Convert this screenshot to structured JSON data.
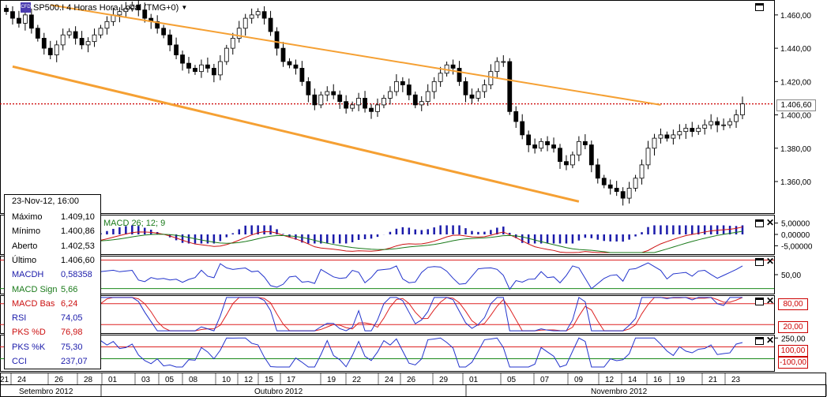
{
  "header": {
    "title": "SP500.I 4 Horas Hora Local (TMG+0)",
    "instrument_icon": "CFD"
  },
  "info_panel": {
    "date": "23-Nov-12, 16:00",
    "rows": [
      {
        "label": "Máximo",
        "value": "1.409,10",
        "color": "#000000"
      },
      {
        "label": "Mínimo",
        "value": "1.400,86",
        "color": "#000000"
      },
      {
        "label": "Aberto",
        "value": "1.402,53",
        "color": "#000000"
      },
      {
        "label": "Último",
        "value": "1.406,60",
        "color": "#000000"
      },
      {
        "label": "MACDH",
        "value": "0,58358",
        "color": "#1a1aaa"
      },
      {
        "label": "MACD Sign",
        "value": "5,66",
        "color": "#1a7a1a"
      },
      {
        "label": "MACD Bas",
        "value": "6,24",
        "color": "#cc1111"
      },
      {
        "label": "RSI",
        "value": "74,05",
        "color": "#1a1aaa"
      },
      {
        "label": "PKS %D",
        "value": "76,98",
        "color": "#cc1111"
      },
      {
        "label": "PKS %K",
        "value": "75,30",
        "color": "#1a1aaa"
      },
      {
        "label": "CCI",
        "value": "237,07",
        "color": "#1a1aaa"
      }
    ]
  },
  "price_axis": {
    "ticks": [
      "1.460,00",
      "1.440,00",
      "1.420,00",
      "1.400,00",
      "1.380,00",
      "1.360,00"
    ],
    "current_price": "1.406,60"
  },
  "macd_panel": {
    "legend": "MACD 26; 12; 9",
    "ticks": [
      "5,00000",
      "0,00000",
      "-5,00000"
    ]
  },
  "rsi_panel": {
    "ticks": [
      "50,00"
    ]
  },
  "stoch_panel": {
    "ticks": [
      "80,00",
      "20,00"
    ]
  },
  "cci_panel": {
    "ticks": [
      "250,00",
      "100,00",
      "-100,00"
    ]
  },
  "x_axis": {
    "days": [
      "21",
      "24",
      "26",
      "28",
      "01",
      "03",
      "05",
      "08",
      "10",
      "12",
      "15",
      "17",
      "19",
      "22",
      "24",
      "26",
      "29",
      "01",
      "05",
      "07",
      "09",
      "12",
      "14",
      "16",
      "19",
      "21",
      "23"
    ],
    "months": [
      "Setembro 2012",
      "Outubro 2012",
      "Novembro 2012"
    ]
  },
  "colors": {
    "candle_up": "#ffffff",
    "candle_down": "#000000",
    "trendline": "#f5a033",
    "price_line": "#cc0000",
    "macd_hist": "#1a1aaa",
    "macd_line": "#cc1111",
    "signal_line": "#1a7a1a",
    "indicator_blue": "#2233cc",
    "indicator_red": "#dd2222",
    "level_green": "#1a8a1a"
  },
  "chart_data": {
    "type": "line",
    "title": "SP500.I 4 Horas Hora Local (TMG+0)",
    "ylim": [
      1342,
      1468
    ],
    "current_price": 1406.6,
    "close_series": [
      1462,
      1458,
      1455,
      1460,
      1452,
      1446,
      1440,
      1436,
      1442,
      1448,
      1450,
      1446,
      1442,
      1444,
      1448,
      1452,
      1456,
      1460,
      1462,
      1464,
      1466,
      1463,
      1458,
      1456,
      1452,
      1448,
      1442,
      1436,
      1431,
      1428,
      1426,
      1430,
      1428,
      1424,
      1432,
      1440,
      1446,
      1452,
      1458,
      1460,
      1462,
      1458,
      1450,
      1440,
      1432,
      1430,
      1428,
      1420,
      1412,
      1406,
      1412,
      1414,
      1412,
      1408,
      1404,
      1406,
      1410,
      1404,
      1402,
      1406,
      1410,
      1414,
      1420,
      1418,
      1412,
      1406,
      1408,
      1414,
      1420,
      1425,
      1430,
      1428,
      1420,
      1412,
      1410,
      1414,
      1418,
      1426,
      1432,
      1432,
      1402,
      1396,
      1388,
      1382,
      1380,
      1384,
      1382,
      1380,
      1372,
      1370,
      1376,
      1384,
      1382,
      1370,
      1362,
      1358,
      1356,
      1354,
      1350,
      1356,
      1362,
      1370,
      1380,
      1386,
      1388,
      1386,
      1388,
      1390,
      1392,
      1390,
      1392,
      1394,
      1396,
      1394,
      1394,
      1396,
      1400,
      1406.6
    ],
    "trendlines": [
      {
        "name": "upper",
        "points": [
          [
            7,
            1466
          ],
          [
            104,
            1406
          ]
        ]
      },
      {
        "name": "lower",
        "points": [
          [
            1,
            1429
          ],
          [
            91,
            1348
          ]
        ]
      }
    ],
    "macd_axis": [
      -5,
      0,
      5
    ],
    "rsi_axis": [
      50
    ],
    "stochastic_levels": [
      20,
      80
    ],
    "cci_levels": [
      -100,
      100,
      250
    ]
  }
}
